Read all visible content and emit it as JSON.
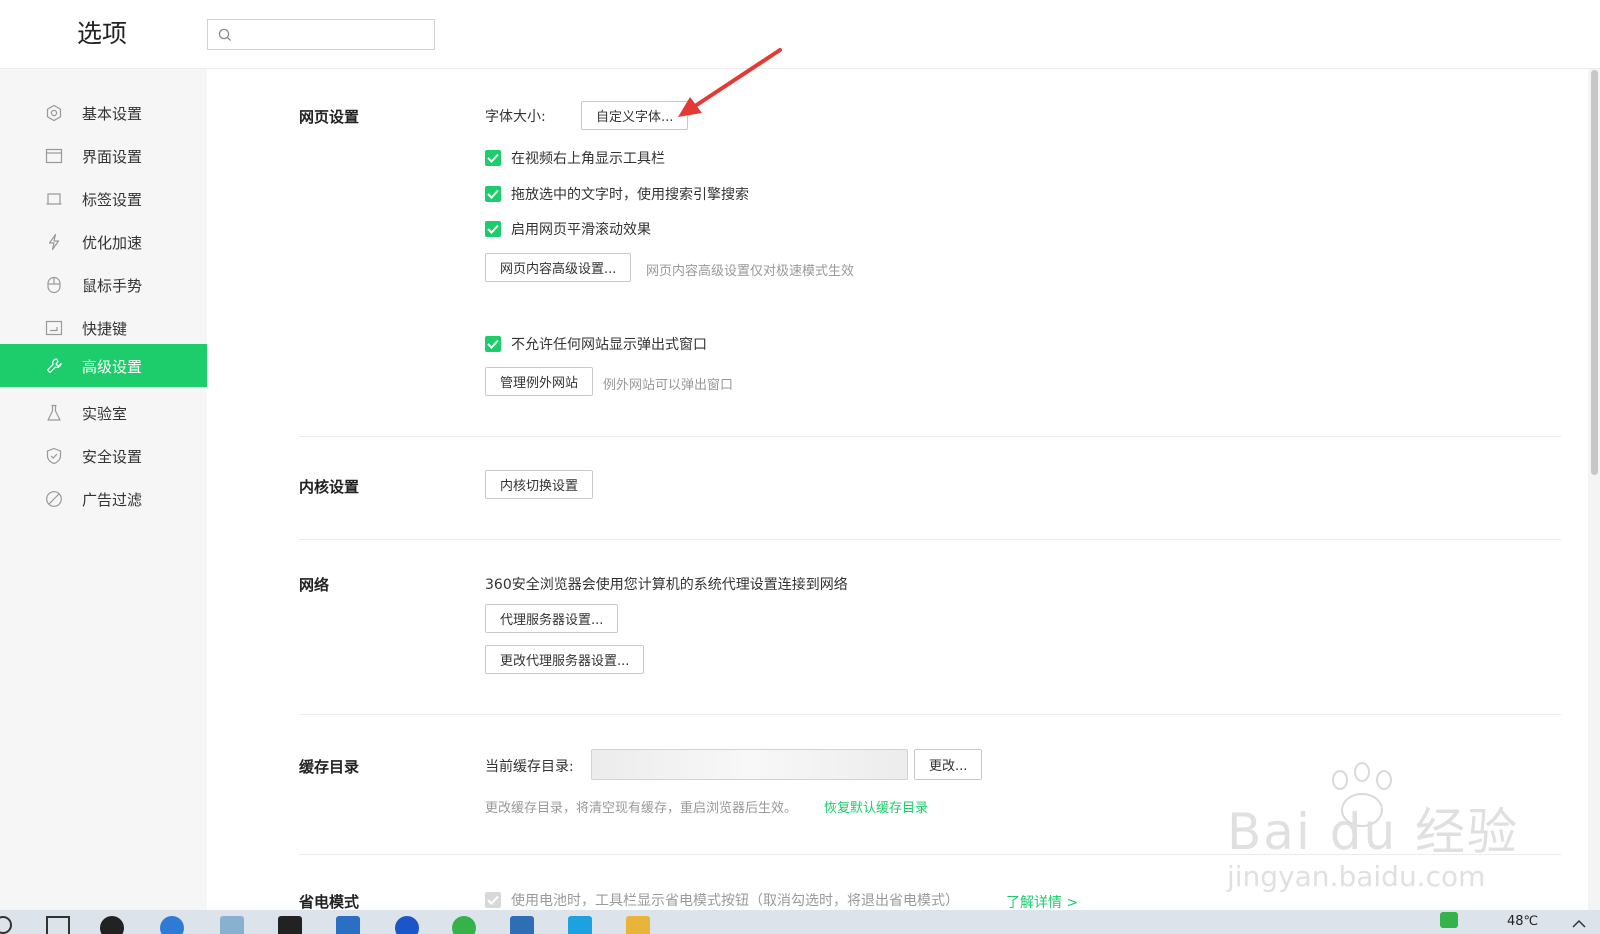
{
  "header": {
    "title": "选项",
    "search_placeholder": ""
  },
  "sidebar": {
    "items": [
      {
        "label": "基本设置",
        "icon": "gear-icon"
      },
      {
        "label": "界面设置",
        "icon": "window-icon"
      },
      {
        "label": "标签设置",
        "icon": "tab-icon"
      },
      {
        "label": "优化加速",
        "icon": "lightning-icon"
      },
      {
        "label": "鼠标手势",
        "icon": "mouse-icon"
      },
      {
        "label": "快捷键",
        "icon": "keyboard-icon"
      },
      {
        "label": "高级设置",
        "icon": "wrench-icon",
        "active": true
      },
      {
        "label": "实验室",
        "icon": "flask-icon"
      },
      {
        "label": "安全设置",
        "icon": "shield-icon"
      },
      {
        "label": "广告过滤",
        "icon": "block-icon"
      }
    ]
  },
  "webpage": {
    "title": "网页设置",
    "font_size_label": "字体大小:",
    "custom_font_button": "自定义字体...",
    "check_video_toolbar": "在视频右上角显示工具栏",
    "check_drag_search": "拖放选中的文字时，使用搜索引擎搜索",
    "check_smooth_scroll": "启用网页平滑滚动效果",
    "advanced_content_button": "网页内容高级设置...",
    "advanced_content_hint": "网页内容高级设置仅对极速模式生效",
    "check_block_popups": "不允许任何网站显示弹出式窗口",
    "manage_exceptions_button": "管理例外网站",
    "manage_exceptions_hint": "例外网站可以弹出窗口"
  },
  "kernel": {
    "title": "内核设置",
    "switch_button": "内核切换设置"
  },
  "network": {
    "title": "网络",
    "description": "360安全浏览器会使用您计算机的系统代理设置连接到网络",
    "proxy_button": "代理服务器设置...",
    "change_proxy_button": "更改代理服务器设置..."
  },
  "cache": {
    "title": "缓存目录",
    "current_label": "当前缓存目录:",
    "change_button": "更改...",
    "note": "更改缓存目录，将清空现有缓存，重启浏览器后生效。",
    "restore_link": "恢复默认缓存目录"
  },
  "power": {
    "title": "省电模式",
    "check_battery": "使用电池时，工具栏显示省电模式按钮（取消勾选时，将退出省电模式）",
    "learn_more_link": "了解详情 >"
  },
  "watermark": {
    "brand": "Bai du 经验",
    "url": "jingyan.baidu.com"
  },
  "taskbar": {
    "temperature": "48℃"
  },
  "colors": {
    "accent": "#1dcc6b",
    "annotation_arrow": "#e53935"
  }
}
